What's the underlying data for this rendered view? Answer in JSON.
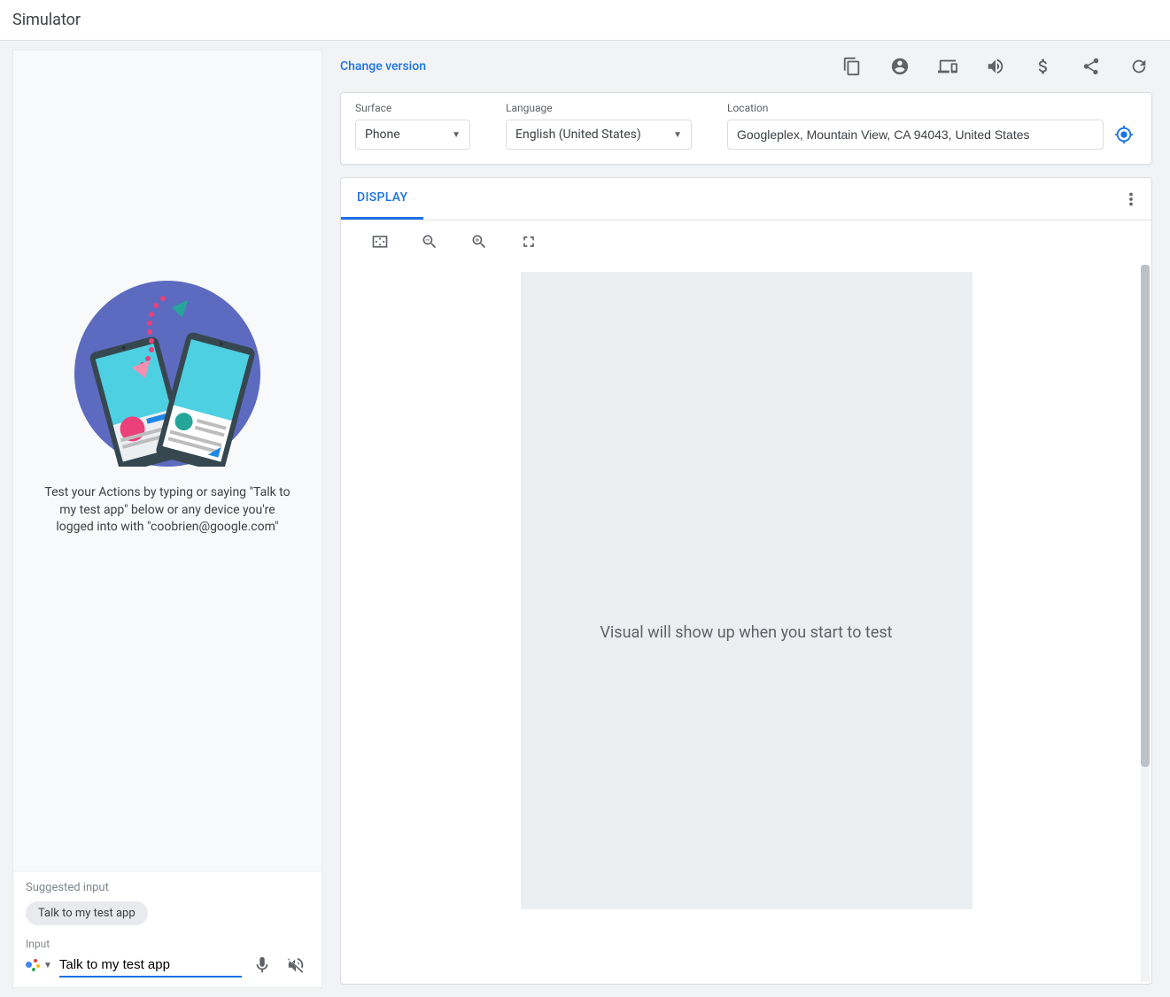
{
  "header": {
    "title": "Simulator"
  },
  "left": {
    "intro": "Test your Actions by typing or saying \"Talk to my test app\" below or any device you're logged into with \"coobrien@google.com\"",
    "suggested_label": "Suggested input",
    "suggestion_chip": "Talk to my test app",
    "input_label": "Input",
    "input_value": "Talk to my test app"
  },
  "top": {
    "change_version": "Change version"
  },
  "settings": {
    "surface_label": "Surface",
    "surface_value": "Phone",
    "language_label": "Language",
    "language_value": "English (United States)",
    "location_label": "Location",
    "location_value": "Googleplex, Mountain View, CA 94043, United States"
  },
  "display": {
    "tab": "DISPLAY",
    "placeholder": "Visual will show up when you start to test"
  }
}
